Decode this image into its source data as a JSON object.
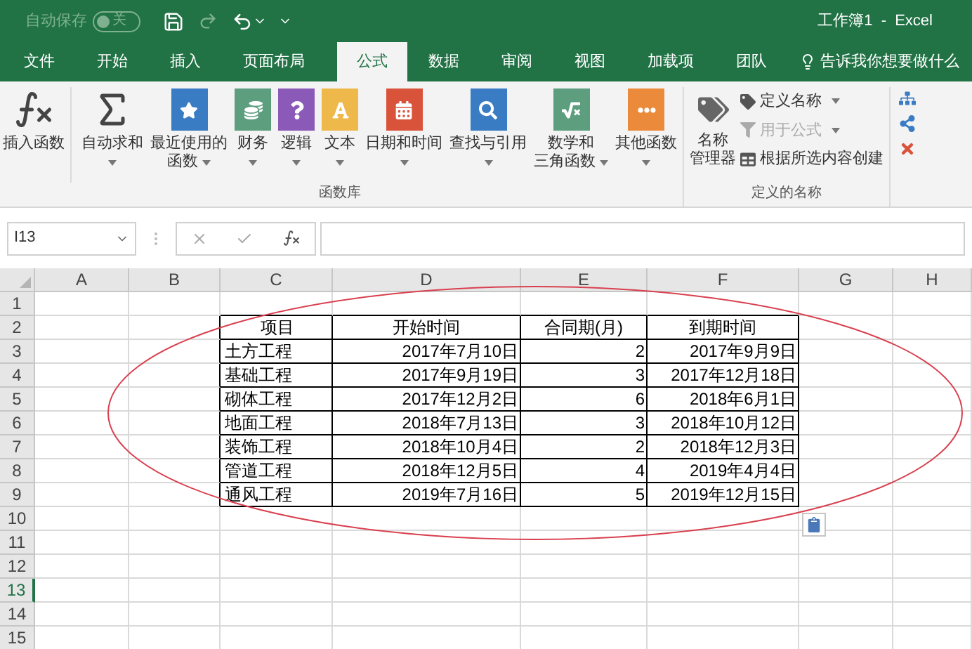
{
  "title_bar": {
    "autosave": {
      "label": "自动保存",
      "on": false,
      "state_text": "关"
    },
    "title": "工作簿1  -  Excel"
  },
  "tabs": [
    {
      "label": "文件",
      "selected": false
    },
    {
      "label": "开始",
      "selected": false
    },
    {
      "label": "插入",
      "selected": false
    },
    {
      "label": "页面布局",
      "selected": false
    },
    {
      "label": "公式",
      "selected": true
    },
    {
      "label": "数据",
      "selected": false
    },
    {
      "label": "审阅",
      "selected": false
    },
    {
      "label": "视图",
      "selected": false
    },
    {
      "label": "加载项",
      "selected": false
    },
    {
      "label": "团队",
      "selected": false
    }
  ],
  "tell_me": {
    "placeholder": "告诉我你想要做什么"
  },
  "ribbon": {
    "function_library": {
      "label": "函数库",
      "buttons": [
        {
          "kind": "insert",
          "lines": [
            "插入函数"
          ],
          "dropdown": false
        },
        {
          "kind": "autosum",
          "lines": [
            "自动求和"
          ],
          "dropdown": true
        },
        {
          "kind": "recent",
          "lines": [
            "最近使用的",
            "函数"
          ],
          "dropdown": true
        },
        {
          "kind": "finance",
          "lines": [
            "财务"
          ],
          "dropdown": true
        },
        {
          "kind": "logic",
          "lines": [
            "逻辑"
          ],
          "dropdown": true
        },
        {
          "kind": "text",
          "lines": [
            "文本"
          ],
          "dropdown": true
        },
        {
          "kind": "date",
          "lines": [
            "日期和时间"
          ],
          "dropdown": true
        },
        {
          "kind": "lookup",
          "lines": [
            "查找与引用"
          ],
          "dropdown": true
        },
        {
          "kind": "math",
          "lines": [
            "数学和",
            "三角函数"
          ],
          "dropdown": true
        },
        {
          "kind": "more",
          "lines": [
            "其他函数"
          ],
          "dropdown": true
        }
      ]
    },
    "defined_names": {
      "label": "定义的名称",
      "manager": [
        "名称",
        "管理器"
      ],
      "items": [
        {
          "kind": "define",
          "label": "定义名称",
          "dropdown": true,
          "disabled": false
        },
        {
          "kind": "use",
          "label": "用于公式",
          "dropdown": true,
          "disabled": true
        },
        {
          "kind": "create",
          "label": "根据所选内容创建",
          "dropdown": false,
          "disabled": false
        }
      ]
    }
  },
  "formula_bar": {
    "name_box": "I13"
  },
  "sheet": {
    "columns": [
      "A",
      "B",
      "C",
      "D",
      "E",
      "F",
      "G",
      "H"
    ],
    "rows": [
      {
        "label": "1",
        "selected": false
      },
      {
        "label": "2",
        "selected": false
      },
      {
        "label": "3",
        "selected": false
      },
      {
        "label": "4",
        "selected": false
      },
      {
        "label": "5",
        "selected": false
      },
      {
        "label": "6",
        "selected": false
      },
      {
        "label": "7",
        "selected": false
      },
      {
        "label": "8",
        "selected": false
      },
      {
        "label": "9",
        "selected": false
      },
      {
        "label": "10",
        "selected": false
      },
      {
        "label": "11",
        "selected": false
      },
      {
        "label": "12",
        "selected": false
      },
      {
        "label": "13",
        "selected": true
      },
      {
        "label": "14",
        "selected": false
      },
      {
        "label": "15",
        "selected": false
      }
    ],
    "table": {
      "headers": [
        "项目",
        "开始时间",
        "合同期(月)",
        "到期时间"
      ],
      "rows": [
        [
          "土方工程",
          "2017年7月10日",
          "2",
          "2017年9月9日"
        ],
        [
          "基础工程",
          "2017年9月19日",
          "3",
          "2017年12月18日"
        ],
        [
          "砌体工程",
          "2017年12月2日",
          "6",
          "2018年6月1日"
        ],
        [
          "地面工程",
          "2018年7月13日",
          "3",
          "2018年10月12日"
        ],
        [
          "装饰工程",
          "2018年10月4日",
          "2",
          "2018年12月3日"
        ],
        [
          "管道工程",
          "2018年12月5日",
          "4",
          "2019年4月4日"
        ],
        [
          "通风工程",
          "2019年7月16日",
          "5",
          "2019年12月15日"
        ]
      ]
    }
  }
}
